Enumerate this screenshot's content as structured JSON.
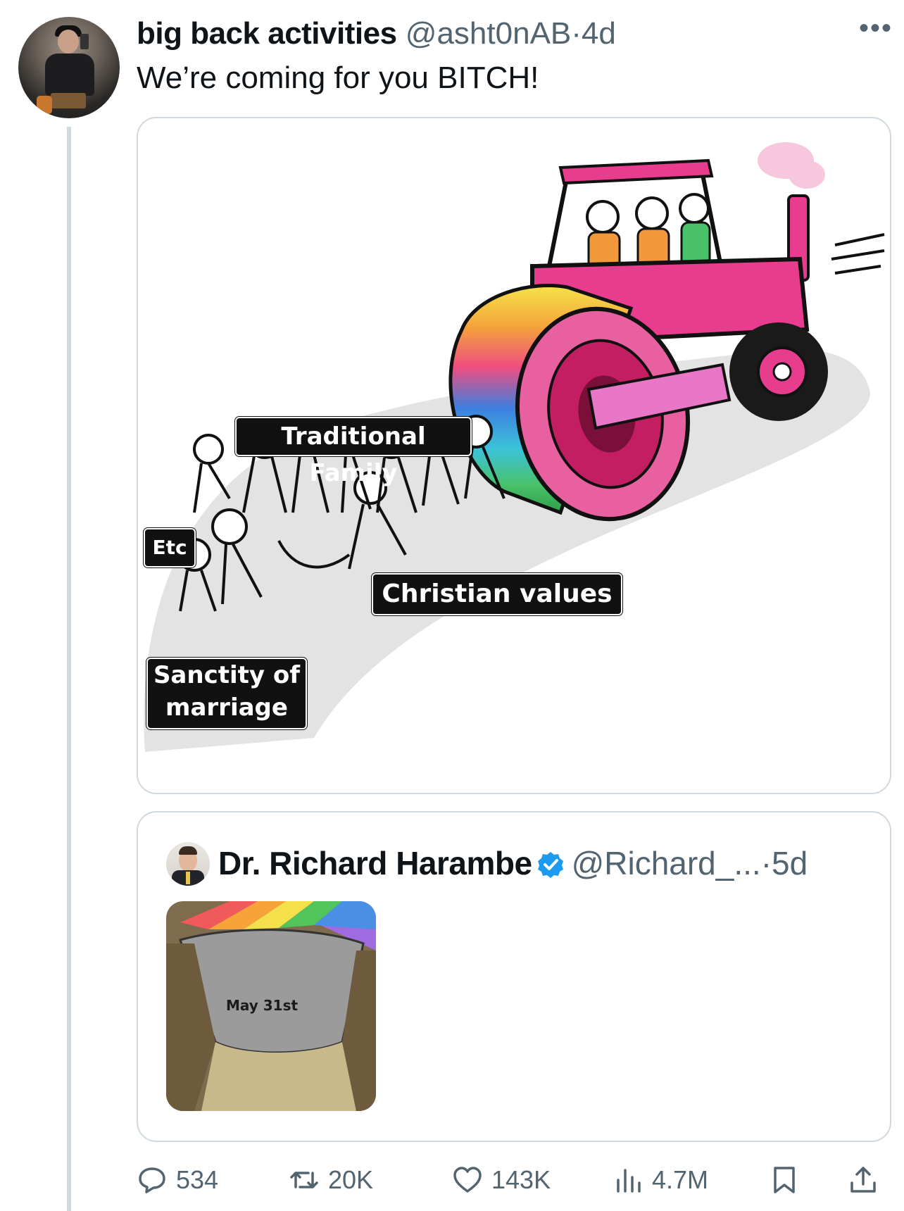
{
  "tweet": {
    "author_name": "big back activities",
    "handle": "@asht0nAB",
    "separator": "·",
    "time": "4d",
    "text": "We’re coming for you BITCH!",
    "more_icon": "more-horizontal-icon"
  },
  "meme": {
    "labels": {
      "traditional_family": "Traditional Family",
      "etc": "Etc",
      "christian_values": "Christian values",
      "sanctity_of_marriage": "Sanctity of\nmarriage"
    }
  },
  "quote": {
    "author_name": "Dr. Richard Harambe",
    "verified_icon": "verified-badge-icon",
    "handle": "@Richard_...",
    "separator": "·",
    "time": "5d",
    "image_label": "May 31st"
  },
  "actions": {
    "reply_count": "534",
    "retweet_count": "20K",
    "like_count": "143K",
    "views_count": "4.7M"
  },
  "colors": {
    "text_primary": "#0f1419",
    "text_secondary": "#536471",
    "border": "#cfd9de",
    "verified_blue": "#1d9bf0",
    "roller_pink": "#e83c8f"
  }
}
